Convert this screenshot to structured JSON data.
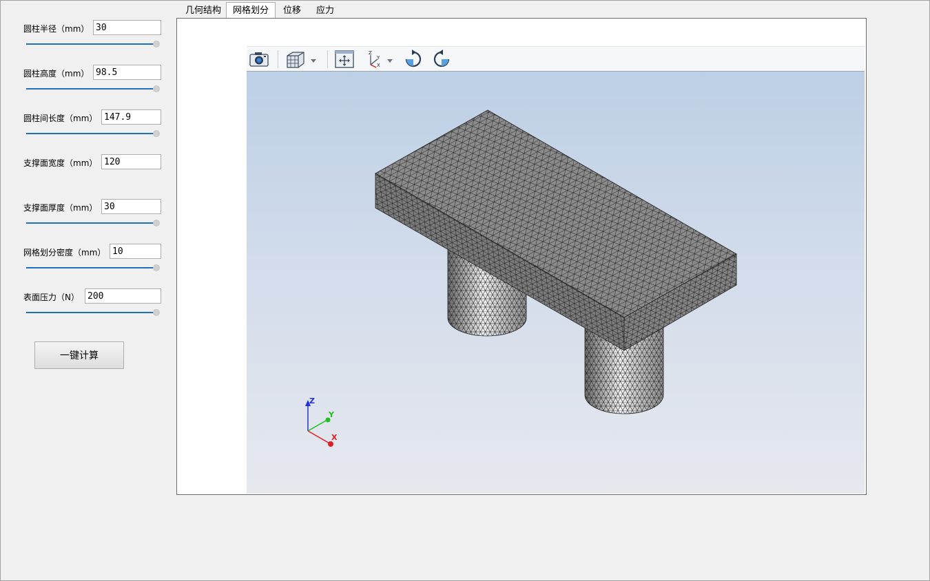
{
  "params": [
    {
      "label": "圆柱半径（mm）",
      "value": "30"
    },
    {
      "label": "圆柱高度（mm）",
      "value": "98.5"
    },
    {
      "label": "圆柱间长度（mm）",
      "value": "147.9"
    },
    {
      "label": "支撑面宽度（mm）",
      "value": "120"
    },
    {
      "label": "支撑面厚度（mm）",
      "value": "30"
    },
    {
      "label": "网格划分密度（mm）",
      "value": "10"
    },
    {
      "label": "表面压力（N）",
      "value": "200"
    }
  ],
  "calc_button": "一键计算",
  "tabs": [
    {
      "label": "几何结构"
    },
    {
      "label": "网格划分"
    },
    {
      "label": "位移"
    },
    {
      "label": "应力"
    }
  ],
  "active_tab": "网格划分",
  "toolbar": {
    "icons": [
      "camera-icon",
      "view-cube-icon",
      "fit-all-icon",
      "axes-icon",
      "rotate-cw-icon",
      "rotate-ccw-icon"
    ]
  },
  "triad": {
    "x_label": "X",
    "y_label": "Y",
    "z_label": "Z"
  },
  "colors": {
    "slider_track": "#1f6fbf",
    "mesh_surface": "#8a8a8a",
    "mesh_lines": "#1a1a1a",
    "axis_x": "#e02020",
    "axis_y": "#20c020",
    "axis_z": "#2030e0"
  }
}
